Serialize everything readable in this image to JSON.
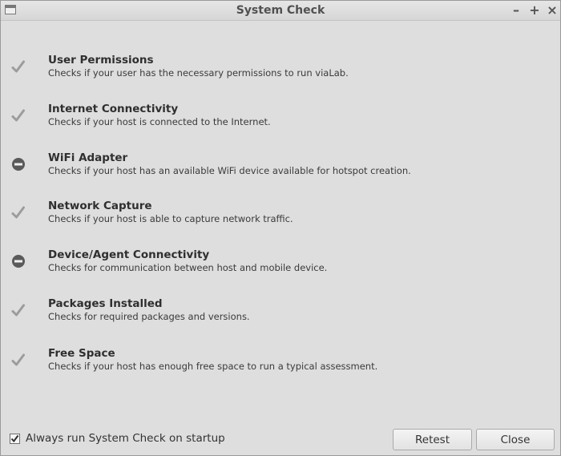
{
  "window": {
    "title": "System Check",
    "controls": {
      "minimize": "–",
      "maximize": "+",
      "close": "×"
    }
  },
  "checks": [
    {
      "title": "User Permissions",
      "description": "Checks if your user has the necessary permissions to run viaLab.",
      "status": "passed",
      "icon": "check-icon"
    },
    {
      "title": "Internet Connectivity",
      "description": "Checks if your host is connected to the Internet.",
      "status": "passed",
      "icon": "check-icon"
    },
    {
      "title": "WiFi Adapter",
      "description": "Checks if your host has an available WiFi device available for hotspot creation.",
      "status": "unavailable",
      "icon": "minus-circle-icon"
    },
    {
      "title": "Network Capture",
      "description": "Checks if your host is able to capture network traffic.",
      "status": "passed",
      "icon": "check-icon"
    },
    {
      "title": "Device/Agent Connectivity",
      "description": "Checks for communication between host and mobile device.",
      "status": "unavailable",
      "icon": "minus-circle-icon"
    },
    {
      "title": "Packages Installed",
      "description": "Checks for required packages and versions.",
      "status": "passed",
      "icon": "check-icon"
    },
    {
      "title": "Free Space",
      "description": "Checks if your host has enough free space to run a typical assessment.",
      "status": "passed",
      "icon": "check-icon"
    }
  ],
  "footer": {
    "startup_label": "Always run System Check on startup",
    "startup_checked": true,
    "retest_label": "Retest",
    "close_label": "Close"
  },
  "colors": {
    "window_bg": "#dedede",
    "check_mark": "#9c9c9c",
    "minus_icon": "#5a5a5a"
  }
}
